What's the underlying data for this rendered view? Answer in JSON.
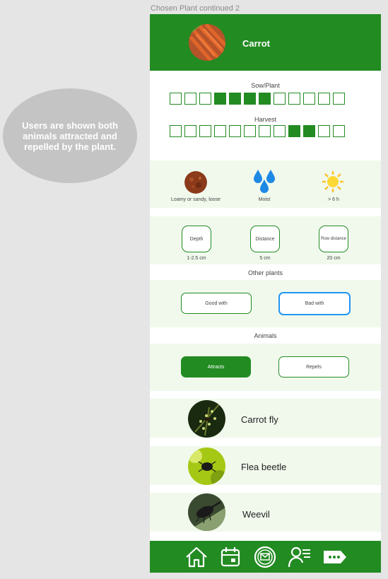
{
  "frame_label": "Chosen Plant continued 2",
  "note": "Users are shown both animals attracted and repelled by the plant.",
  "plant": {
    "name": "Carrot"
  },
  "calendar": {
    "sow_label": "Sow/Plant",
    "sow_months": [
      false,
      false,
      false,
      true,
      true,
      true,
      true,
      false,
      false,
      false,
      false,
      false
    ],
    "harvest_label": "Harvest",
    "harvest_months": [
      false,
      false,
      false,
      false,
      false,
      false,
      false,
      false,
      true,
      true,
      false,
      false
    ]
  },
  "conditions": {
    "soil": {
      "icon": "soil-icon",
      "text": "Loamy or sandy, loose"
    },
    "water": {
      "icon": "water-drops-icon",
      "text": "Moist"
    },
    "sun": {
      "icon": "sun-icon",
      "text": "> 6 h"
    }
  },
  "measurements": {
    "depth": {
      "label": "Depth",
      "value": "1-2.5 cm"
    },
    "distance": {
      "label": "Distance",
      "value": "5 cm"
    },
    "row_distance": {
      "label": "Row distance",
      "value": "20 cm"
    }
  },
  "other_plants": {
    "title": "Other plants",
    "good": "Good with",
    "bad": "Bad with"
  },
  "animals": {
    "title": "Animals",
    "attracts": "Attracts",
    "repels": "Repels",
    "list": [
      {
        "name": "Carrot fly"
      },
      {
        "name": "Flea beetle"
      },
      {
        "name": "Weevil"
      }
    ]
  },
  "colors": {
    "primary": "#228b22",
    "accent_blue": "#2196f3",
    "light_band": "#f1f9ed"
  },
  "nav": [
    "home-icon",
    "calendar-icon",
    "mail-icon",
    "profile-list-icon",
    "more-icon"
  ]
}
